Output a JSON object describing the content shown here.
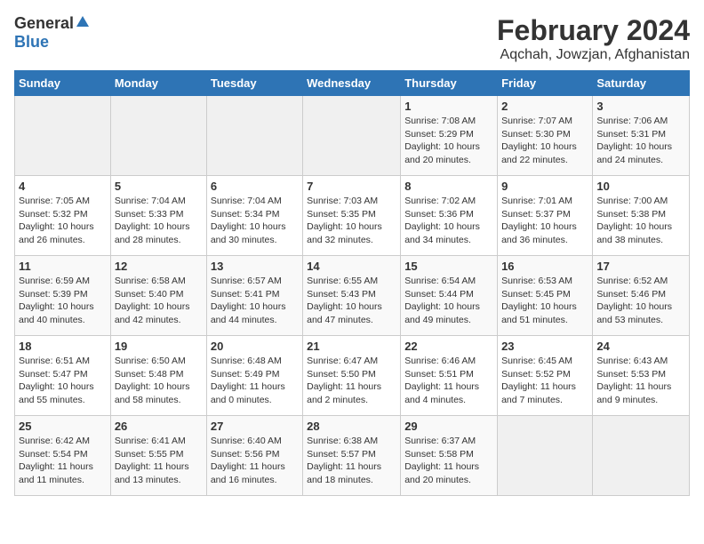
{
  "logo": {
    "general": "General",
    "blue": "Blue"
  },
  "title": "February 2024",
  "location": "Aqchah, Jowzjan, Afghanistan",
  "days_of_week": [
    "Sunday",
    "Monday",
    "Tuesday",
    "Wednesday",
    "Thursday",
    "Friday",
    "Saturday"
  ],
  "weeks": [
    [
      {
        "day": "",
        "info": ""
      },
      {
        "day": "",
        "info": ""
      },
      {
        "day": "",
        "info": ""
      },
      {
        "day": "",
        "info": ""
      },
      {
        "day": "1",
        "info": "Sunrise: 7:08 AM\nSunset: 5:29 PM\nDaylight: 10 hours and 20 minutes."
      },
      {
        "day": "2",
        "info": "Sunrise: 7:07 AM\nSunset: 5:30 PM\nDaylight: 10 hours and 22 minutes."
      },
      {
        "day": "3",
        "info": "Sunrise: 7:06 AM\nSunset: 5:31 PM\nDaylight: 10 hours and 24 minutes."
      }
    ],
    [
      {
        "day": "4",
        "info": "Sunrise: 7:05 AM\nSunset: 5:32 PM\nDaylight: 10 hours and 26 minutes."
      },
      {
        "day": "5",
        "info": "Sunrise: 7:04 AM\nSunset: 5:33 PM\nDaylight: 10 hours and 28 minutes."
      },
      {
        "day": "6",
        "info": "Sunrise: 7:04 AM\nSunset: 5:34 PM\nDaylight: 10 hours and 30 minutes."
      },
      {
        "day": "7",
        "info": "Sunrise: 7:03 AM\nSunset: 5:35 PM\nDaylight: 10 hours and 32 minutes."
      },
      {
        "day": "8",
        "info": "Sunrise: 7:02 AM\nSunset: 5:36 PM\nDaylight: 10 hours and 34 minutes."
      },
      {
        "day": "9",
        "info": "Sunrise: 7:01 AM\nSunset: 5:37 PM\nDaylight: 10 hours and 36 minutes."
      },
      {
        "day": "10",
        "info": "Sunrise: 7:00 AM\nSunset: 5:38 PM\nDaylight: 10 hours and 38 minutes."
      }
    ],
    [
      {
        "day": "11",
        "info": "Sunrise: 6:59 AM\nSunset: 5:39 PM\nDaylight: 10 hours and 40 minutes."
      },
      {
        "day": "12",
        "info": "Sunrise: 6:58 AM\nSunset: 5:40 PM\nDaylight: 10 hours and 42 minutes."
      },
      {
        "day": "13",
        "info": "Sunrise: 6:57 AM\nSunset: 5:41 PM\nDaylight: 10 hours and 44 minutes."
      },
      {
        "day": "14",
        "info": "Sunrise: 6:55 AM\nSunset: 5:43 PM\nDaylight: 10 hours and 47 minutes."
      },
      {
        "day": "15",
        "info": "Sunrise: 6:54 AM\nSunset: 5:44 PM\nDaylight: 10 hours and 49 minutes."
      },
      {
        "day": "16",
        "info": "Sunrise: 6:53 AM\nSunset: 5:45 PM\nDaylight: 10 hours and 51 minutes."
      },
      {
        "day": "17",
        "info": "Sunrise: 6:52 AM\nSunset: 5:46 PM\nDaylight: 10 hours and 53 minutes."
      }
    ],
    [
      {
        "day": "18",
        "info": "Sunrise: 6:51 AM\nSunset: 5:47 PM\nDaylight: 10 hours and 55 minutes."
      },
      {
        "day": "19",
        "info": "Sunrise: 6:50 AM\nSunset: 5:48 PM\nDaylight: 10 hours and 58 minutes."
      },
      {
        "day": "20",
        "info": "Sunrise: 6:48 AM\nSunset: 5:49 PM\nDaylight: 11 hours and 0 minutes."
      },
      {
        "day": "21",
        "info": "Sunrise: 6:47 AM\nSunset: 5:50 PM\nDaylight: 11 hours and 2 minutes."
      },
      {
        "day": "22",
        "info": "Sunrise: 6:46 AM\nSunset: 5:51 PM\nDaylight: 11 hours and 4 minutes."
      },
      {
        "day": "23",
        "info": "Sunrise: 6:45 AM\nSunset: 5:52 PM\nDaylight: 11 hours and 7 minutes."
      },
      {
        "day": "24",
        "info": "Sunrise: 6:43 AM\nSunset: 5:53 PM\nDaylight: 11 hours and 9 minutes."
      }
    ],
    [
      {
        "day": "25",
        "info": "Sunrise: 6:42 AM\nSunset: 5:54 PM\nDaylight: 11 hours and 11 minutes."
      },
      {
        "day": "26",
        "info": "Sunrise: 6:41 AM\nSunset: 5:55 PM\nDaylight: 11 hours and 13 minutes."
      },
      {
        "day": "27",
        "info": "Sunrise: 6:40 AM\nSunset: 5:56 PM\nDaylight: 11 hours and 16 minutes."
      },
      {
        "day": "28",
        "info": "Sunrise: 6:38 AM\nSunset: 5:57 PM\nDaylight: 11 hours and 18 minutes."
      },
      {
        "day": "29",
        "info": "Sunrise: 6:37 AM\nSunset: 5:58 PM\nDaylight: 11 hours and 20 minutes."
      },
      {
        "day": "",
        "info": ""
      },
      {
        "day": "",
        "info": ""
      }
    ]
  ]
}
